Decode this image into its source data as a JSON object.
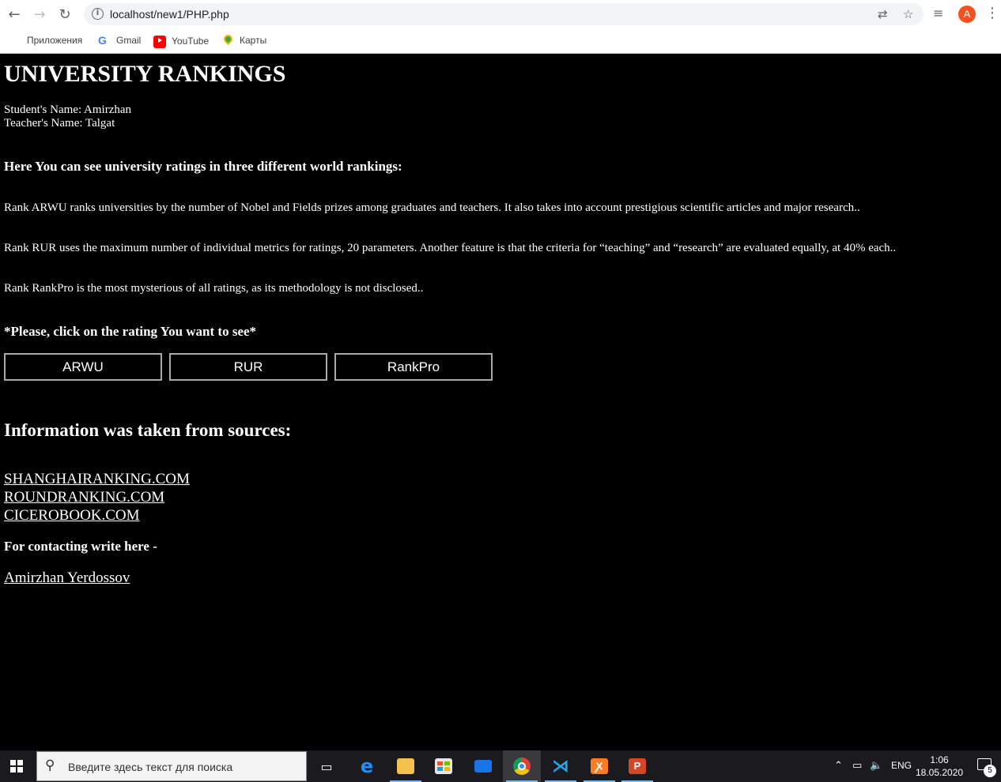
{
  "browser": {
    "url": "localhost/new1/PHP.php",
    "avatar_letter": "A",
    "bookmarks": [
      {
        "label": "Приложения",
        "icon": "apps-grid-icon"
      },
      {
        "label": "Gmail",
        "icon": "google-icon"
      },
      {
        "label": "YouTube",
        "icon": "youtube-icon"
      },
      {
        "label": "Карты",
        "icon": "maps-pin-icon"
      }
    ]
  },
  "page": {
    "title": "UNIVERSITY RANKINGS",
    "student": "Student's Name: Amirzhan",
    "teacher": "Teacher's Name: Talgat",
    "intro": "Here You can see university ratings in three different world rankings:",
    "desc_arwu": "Rank ARWU ranks universities by the number of Nobel and Fields prizes among graduates and teachers. It also takes into account prestigious scientific articles and major research..",
    "desc_rur": "Rank RUR uses the maximum number of individual metrics for ratings, 20 parameters. Another feature is that the criteria for “teaching” and “research” are evaluated equally, at 40% each..",
    "desc_rankpro": "Rank RankPro is the most mysterious of all ratings, as its methodology is not disclosed..",
    "prompt": "*Please, click on the rating You want to see*",
    "buttons": [
      "ARWU",
      "RUR",
      "RankPro"
    ],
    "sources_heading": "Information was taken from sources:",
    "sources": [
      "SHANGHAIRANKING.COM",
      "ROUNDRANKING.COM",
      "CICEROBOOK.COM"
    ],
    "contact_label": "For contacting write here -",
    "contact_name": "Amirzhan Yerdossov"
  },
  "taskbar": {
    "search_placeholder": "Введите здесь текст для поиска",
    "lang": "ENG",
    "time": "1:06",
    "date": "18.05.2020",
    "notifications": "5"
  },
  "colors": {
    "page_bg": "#000000",
    "text": "#ffffff",
    "button_border": "#a9a9a9",
    "avatar": "#f4511e"
  }
}
